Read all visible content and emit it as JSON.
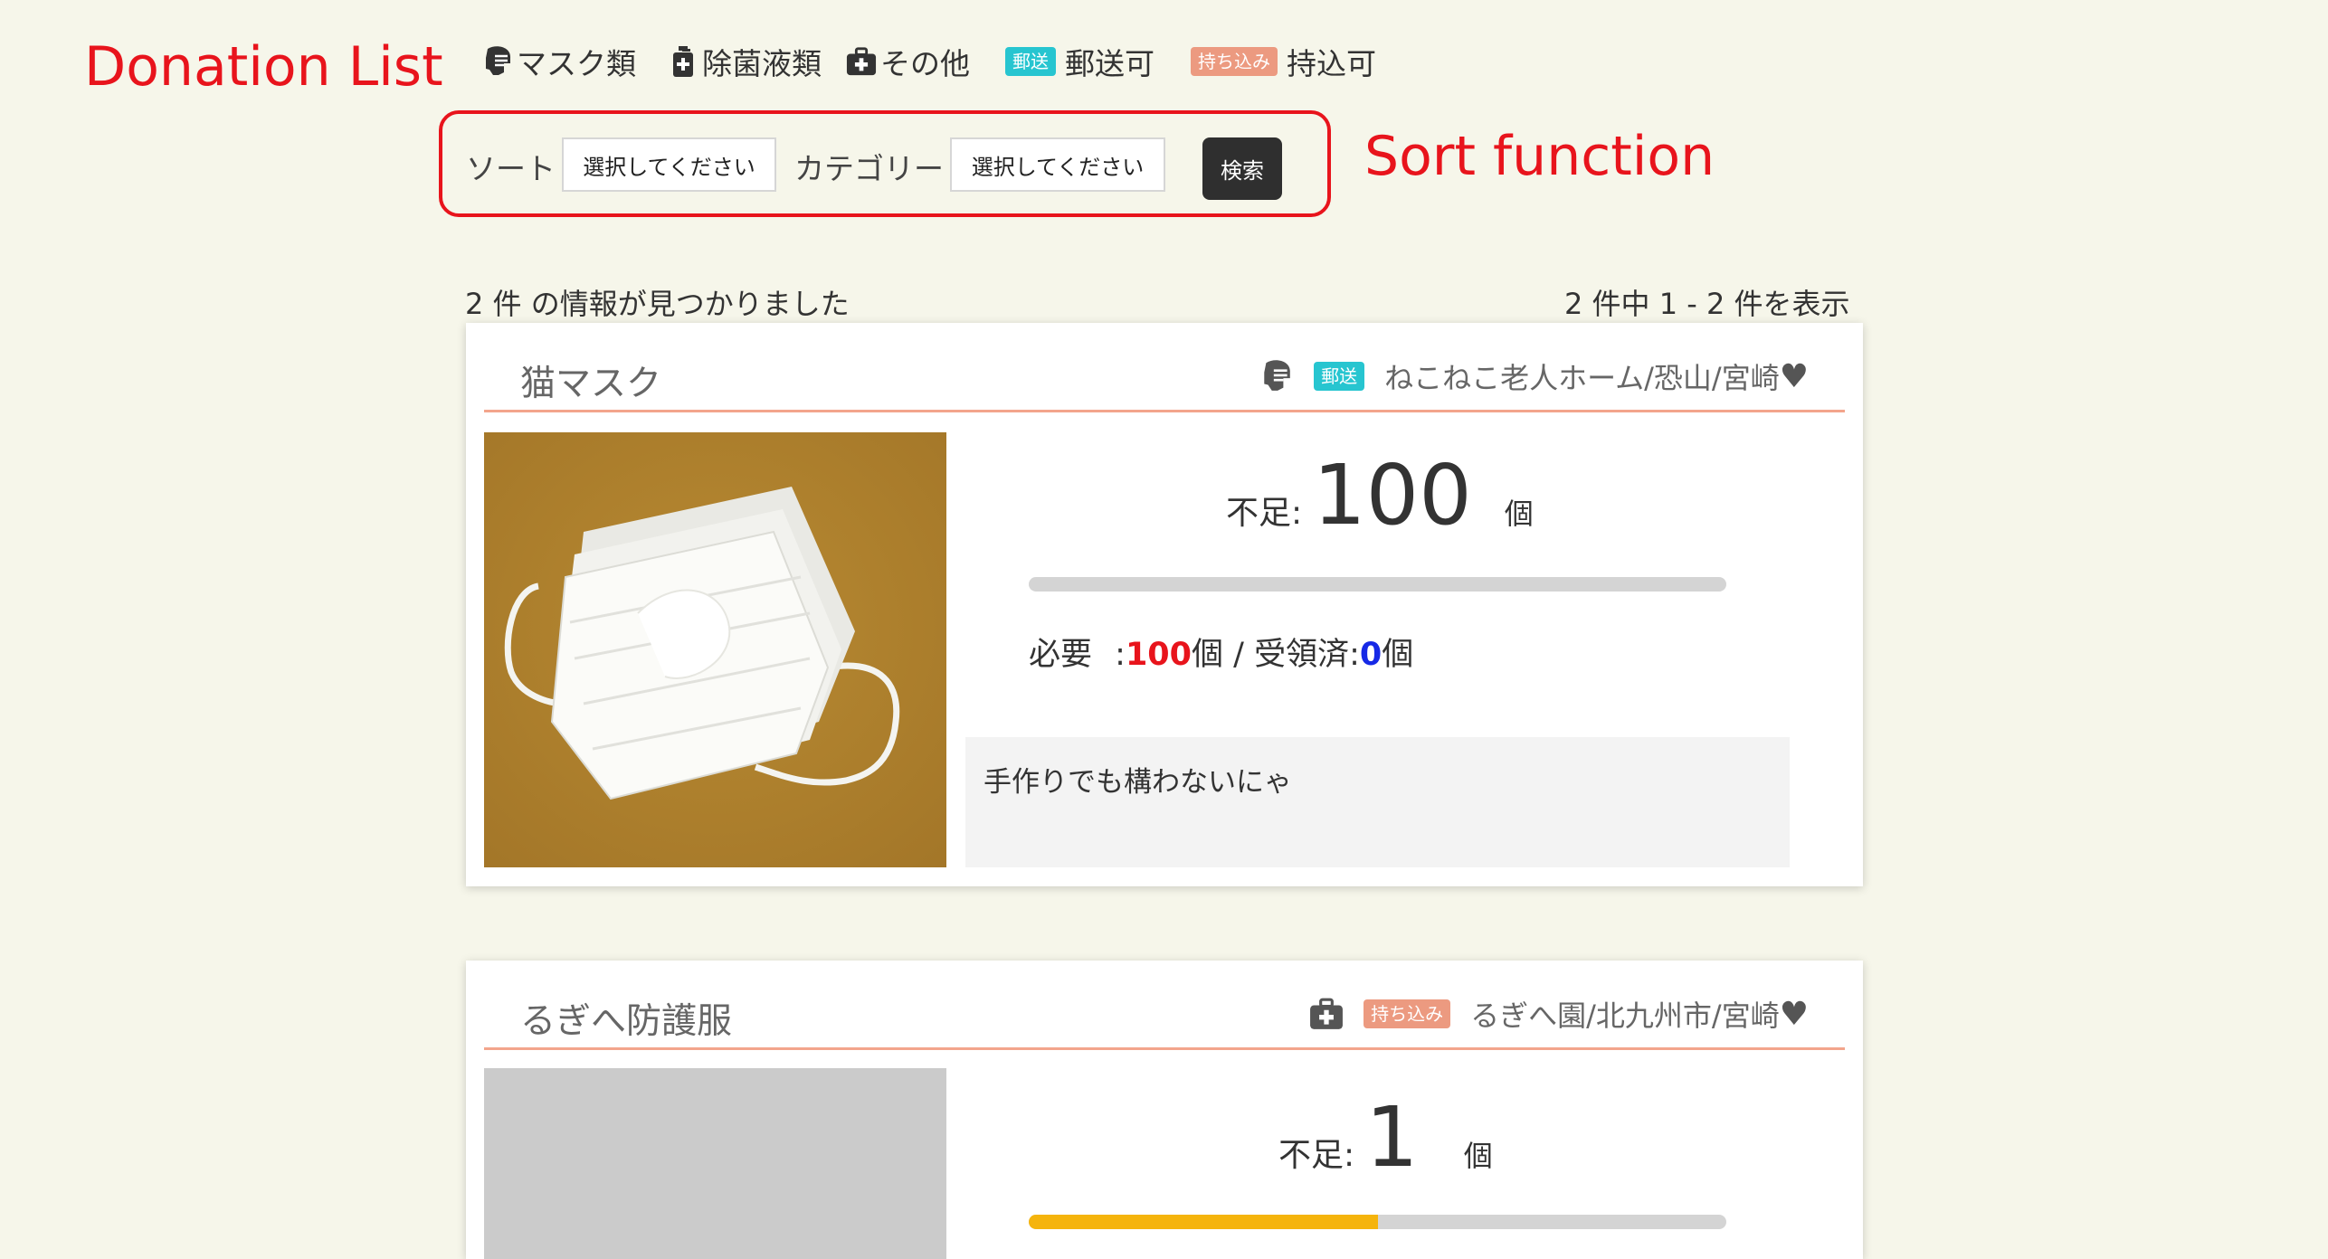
{
  "annotations": {
    "donation_list": "Donation List",
    "sort_function": "Sort function"
  },
  "legend": {
    "mask": "マスク類",
    "disinfectant": "除菌液類",
    "other": "その他",
    "mail_badge": "郵送",
    "mail_label": "郵送可",
    "bring_badge": "持ち込み",
    "bring_label": "持込可"
  },
  "sort": {
    "sort_label": "ソート",
    "sort_value": "選択してください",
    "category_label": "カテゴリー",
    "category_value": "選択してください",
    "search_button": "検索"
  },
  "results": {
    "found": "2 件 の情報が見つかりました",
    "range": "2 件中 1 - 2 件を表示"
  },
  "items": [
    {
      "title": "猫マスク",
      "category_icon": "mask-icon",
      "badge": "郵送",
      "badge_color": "#27c5d0",
      "location": "ねこねこ老人ホーム/恐山/宮崎",
      "short_label": "不足:",
      "short_value": "100",
      "unit": "個",
      "progress": 0,
      "need_label": "必要",
      "need_colon": ":",
      "need_value": "100",
      "need_unit": "個",
      "separator": "/",
      "received_label": "受領済:",
      "received_value": "0",
      "received_unit": "個",
      "note": "手作りでも構わないにゃ"
    },
    {
      "title": "るぎへ防護服",
      "category_icon": "first-aid-kit-icon",
      "badge": "持ち込み",
      "badge_color": "#ec9a80",
      "location": "るぎへ園/北九州市/宮崎",
      "short_label": "不足:",
      "short_value": "1",
      "unit": "個",
      "progress": 0.5
    }
  ],
  "colors": {
    "accent_red": "#e8141c",
    "mail_badge": "#27c5d0",
    "bring_badge": "#ec9a80",
    "card_rule": "#f3a58c",
    "progress_fill": "#f5b40c",
    "received_blue": "#1629e6"
  }
}
